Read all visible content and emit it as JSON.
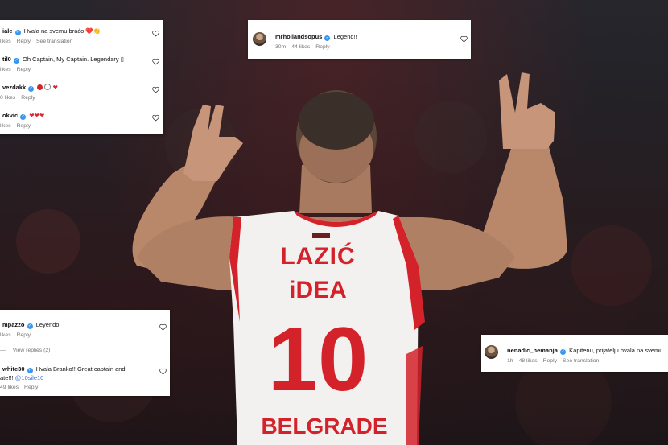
{
  "jersey": {
    "name": "LAZIĆ",
    "sponsor": "iDEA",
    "number": "10",
    "city": "BELGRADE"
  },
  "panel_top_left": {
    "comments": [
      {
        "username": "iale",
        "text": "Hvala na svemu braćo ❤️👏",
        "likes": "likes",
        "reply": "Reply",
        "translate": "See translation"
      },
      {
        "username": "til0",
        "text": "Oh Captain, My Captain. Legendary ▯",
        "likes": "likes",
        "reply": "Reply"
      },
      {
        "username": "vezdakk",
        "text": "",
        "likes": "0 likes",
        "reply": "Reply"
      },
      {
        "username": "okvic",
        "text": "",
        "likes": "likes",
        "reply": "Reply"
      }
    ]
  },
  "panel_top_center": {
    "username": "mrhollandsopus",
    "text": "Legend!!",
    "time": "30m",
    "likes": "44 likes",
    "reply": "Reply"
  },
  "panel_bottom_left": {
    "comments": [
      {
        "username": "mpazzo",
        "text": "Leyendo",
        "likes": "likes",
        "reply": "Reply"
      },
      {
        "username": "white30",
        "text_line1": "Hvala Branko!! Great captain and",
        "text_line2_prefix": "ate!!!",
        "mention": "@10sile10",
        "likes": "49 likes",
        "reply": "Reply"
      }
    ],
    "view_replies": "View replies (2)"
  },
  "panel_right": {
    "username": "nenadic_nemanja",
    "text": "Kapitenu, prijatelju hvala na svemu",
    "time": "1h",
    "likes": "48 likes",
    "reply": "Reply",
    "translate": "See translation"
  },
  "colors": {
    "verified": "#3797f0",
    "jersey_red": "#d4222b",
    "mention": "#3f6ed8"
  },
  "icons": [
    "heart-icon",
    "verified-badge-icon",
    "avatar"
  ]
}
